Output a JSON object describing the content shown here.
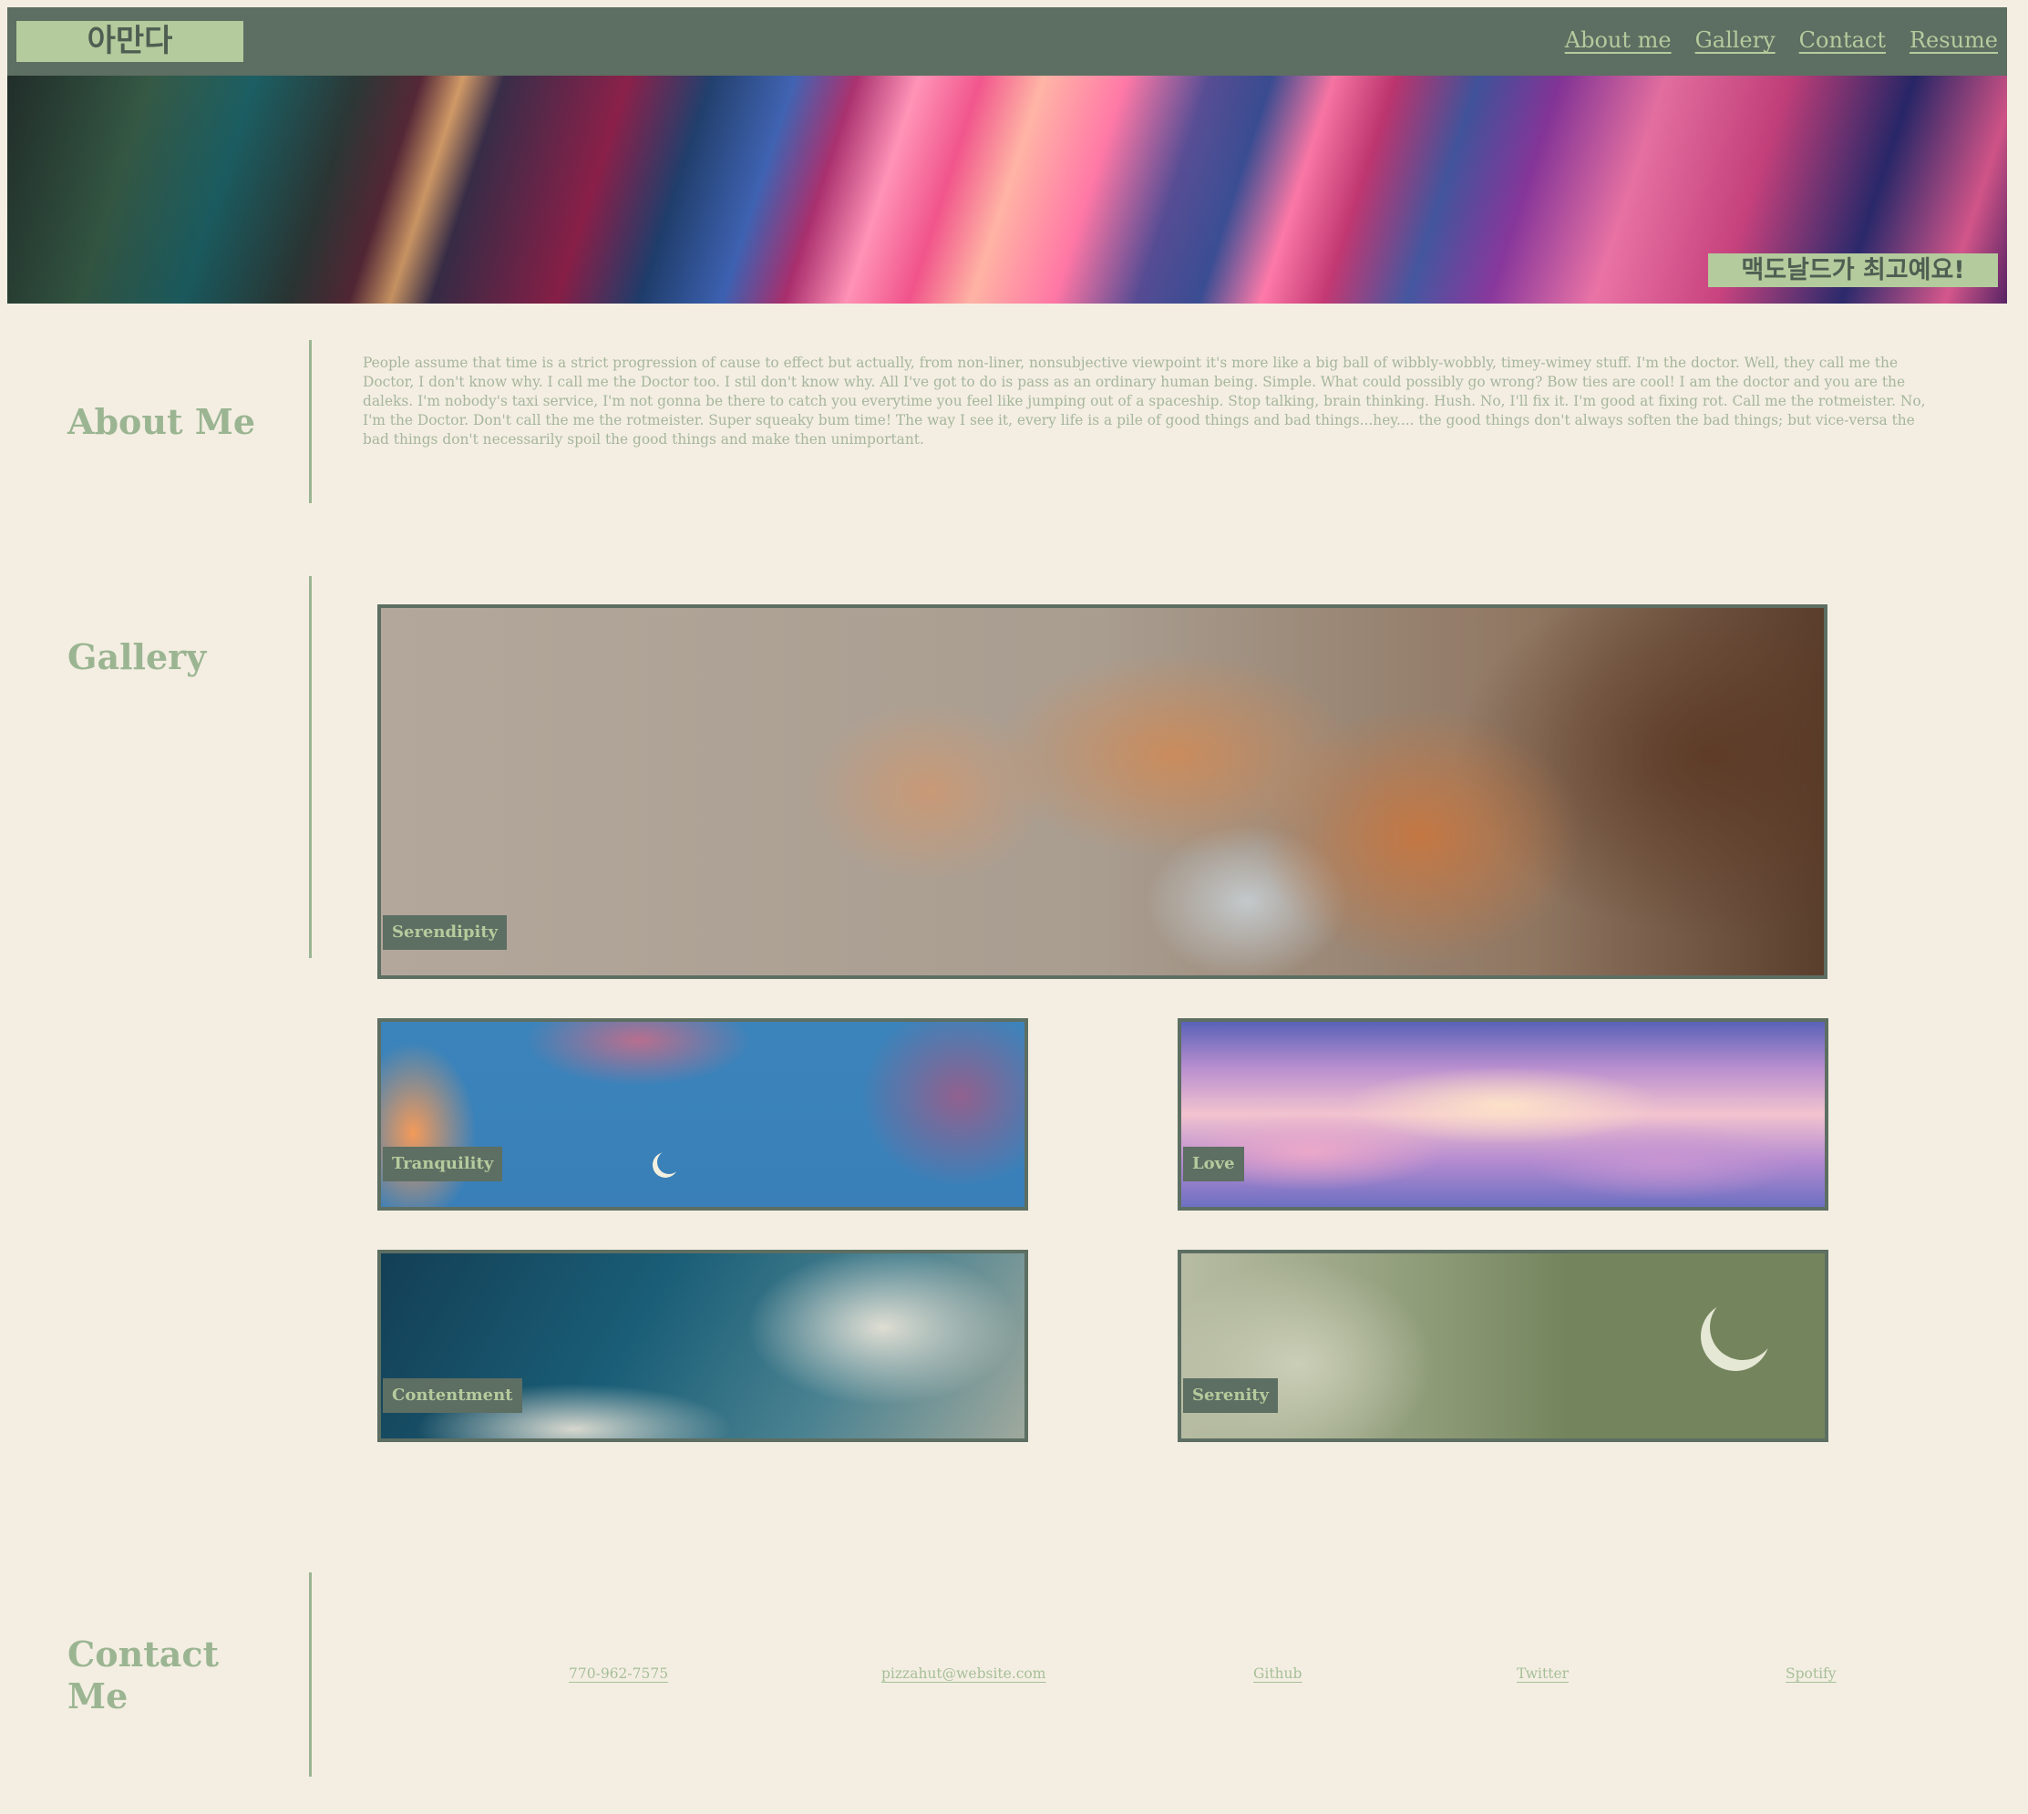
{
  "header": {
    "logo": "아만다",
    "nav": [
      "About me",
      "Gallery",
      "Contact",
      "Resume"
    ]
  },
  "hero": {
    "tag": "맥도날드가 최고예요!"
  },
  "about": {
    "title": "About Me",
    "text": "People assume that time is a strict progression of cause to effect but actually, from non-liner, nonsubjective viewpoint it's more like a big ball of wibbly-wobbly, timey-wimey stuff. I'm the doctor. Well, they call me the Doctor, I don't know why. I call me the Doctor too. I stil don't know why. All I've got to do is pass as an ordinary human being. Simple. What could possibly go wrong? Bow ties are cool! I am the doctor and you are the daleks. I'm nobody's taxi service, I'm not gonna be there to catch you everytime you feel like jumping out of a spaceship. Stop talking, brain thinking. Hush. No, I'll fix it. I'm good at fixing rot. Call me the rotmeister. No, I'm the Doctor. Don't call the me the rotmeister. Super squeaky bum time! The way I see it, every life is a pile of good things and bad things...hey.... the good things don't always soften the bad things; but vice-versa the bad things don't necessarily spoil the good things and make then unimportant."
  },
  "gallery": {
    "title": "Gallery",
    "items": [
      "Serendipity",
      "Tranquility",
      "Love",
      "Contentment",
      "Serenity"
    ]
  },
  "contact": {
    "title_line1": "Contact",
    "title_line2": "Me",
    "links": [
      "770-962-7575",
      "pizzahut@website.com",
      "Github",
      "Twitter",
      "Spotify"
    ]
  },
  "colors": {
    "background": "#f4eee2",
    "header": "#5d6e62",
    "accent": "#b4cb9d",
    "heading": "#9bb592"
  }
}
